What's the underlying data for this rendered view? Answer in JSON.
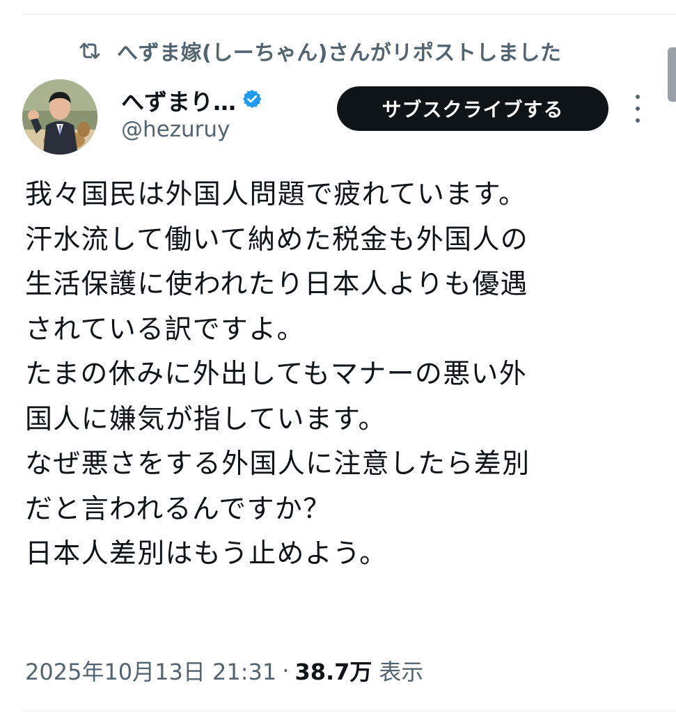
{
  "repost": {
    "text": "へずま嫁(しーちゃん)さんがリポストしました",
    "icon": "repost-icon"
  },
  "author": {
    "display_name": "へずまり…",
    "handle": "@hezuruy",
    "verified": true,
    "verified_color": "#1d9bf0"
  },
  "actions": {
    "subscribe_label": "サブスクライブする",
    "more_icon": "more-vertical-icon"
  },
  "tweet": {
    "lines": [
      "我々国民は外国人問題で疲れています。",
      "汗水流して働いて納めた税金も外国人の",
      "生活保護に使われたり日本人よりも優遇",
      "されている訳ですよ。",
      "たまの休みに外出してもマナーの悪い外",
      "国人に嫌気が指しています。",
      "なぜ悪さをする外国人に注意したら差別",
      "だと言われるんですか？",
      "日本人差別はもう止めよう。"
    ]
  },
  "meta": {
    "datetime": "2025年10月13日 21:31",
    "separator": "·",
    "views_count": "38.7万",
    "views_label": "表示"
  },
  "colors": {
    "text_primary": "#0f1419",
    "text_secondary": "#536471",
    "button_bg": "#0f1419",
    "button_text": "#ffffff"
  }
}
